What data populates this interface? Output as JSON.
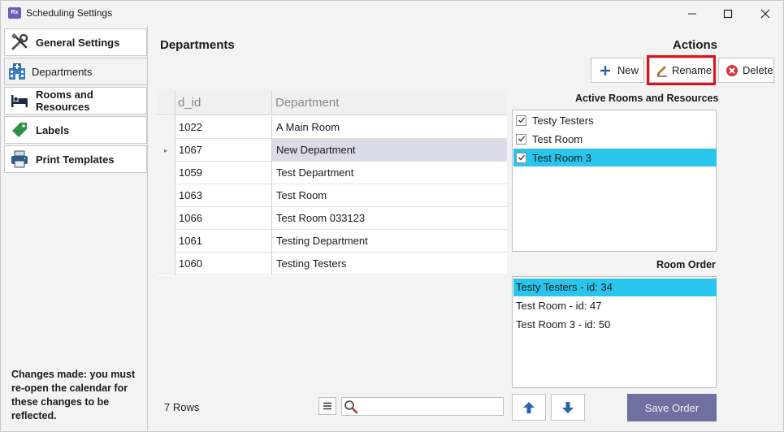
{
  "window": {
    "title": "Scheduling Settings",
    "app_icon_text": "Rx"
  },
  "sidebar": {
    "items": [
      {
        "label": "General Settings",
        "icon": "tools-icon"
      },
      {
        "label": "Departments",
        "icon": "hospital-icon"
      },
      {
        "label": "Rooms and Resources",
        "icon": "bed-icon"
      },
      {
        "label": "Labels",
        "icon": "tag-icon"
      },
      {
        "label": "Print Templates",
        "icon": "printer-icon"
      }
    ],
    "active_index": 1,
    "note": "Changes made: you must re-open the calendar for these changes to be reflected."
  },
  "main": {
    "section_title": "Departments",
    "grid": {
      "columns": [
        "d_id",
        "Department"
      ],
      "rows": [
        {
          "id": "1022",
          "dept": "A Main Room"
        },
        {
          "id": "1067",
          "dept": "New Department"
        },
        {
          "id": "1059",
          "dept": "Test Department"
        },
        {
          "id": "1063",
          "dept": "Test Room"
        },
        {
          "id": "1066",
          "dept": "Test Room 033123"
        },
        {
          "id": "1061",
          "dept": "Testing Department"
        },
        {
          "id": "1060",
          "dept": "Testing Testers"
        }
      ],
      "selected_row": 1,
      "row_indicator": "▸"
    },
    "rows_count": "7 Rows",
    "search": {
      "placeholder": ""
    }
  },
  "actions": {
    "title": "Actions",
    "new_label": "New",
    "rename_label": "Rename",
    "delete_label": "Delete",
    "active_rooms_title": "Active Rooms and Resources",
    "active_rooms": [
      {
        "label": "Testy Testers",
        "checked": true
      },
      {
        "label": "Test Room",
        "checked": true
      },
      {
        "label": "Test Room 3",
        "checked": true
      }
    ],
    "active_selected": 2,
    "room_order_title": "Room Order",
    "room_order": [
      "Testy Testers - id: 34",
      "Test Room - id: 47",
      "Test Room 3 - id: 50"
    ],
    "order_selected": 0,
    "save_order_label": "Save Order"
  },
  "colors": {
    "selection": "#29c5ec",
    "grid_selection": "#dcdbe8",
    "save_button": "#6f6fa1",
    "highlight": "#e0101a"
  }
}
